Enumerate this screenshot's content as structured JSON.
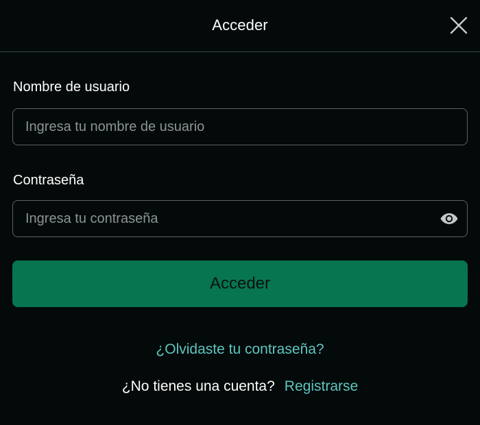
{
  "dialog": {
    "title": "Acceder",
    "close_icon": "close-icon"
  },
  "username": {
    "label": "Nombre de usuario",
    "placeholder": "Ingresa tu nombre de usuario",
    "value": ""
  },
  "password": {
    "label": "Contraseña",
    "placeholder": "Ingresa tu contraseña",
    "value": "",
    "toggle_icon": "eye-icon"
  },
  "submit": {
    "label": "Acceder"
  },
  "forgot_password": {
    "label": "¿Olvidaste tu contraseña?"
  },
  "register": {
    "question": "¿No tienes una cuenta?",
    "link_label": "Registrarse"
  },
  "colors": {
    "background": "#040a0a",
    "accent_button": "#077550",
    "link": "#5fc6c0",
    "input_border": "#5c6362",
    "placeholder": "#8d9494",
    "divider": "#3d4444"
  }
}
